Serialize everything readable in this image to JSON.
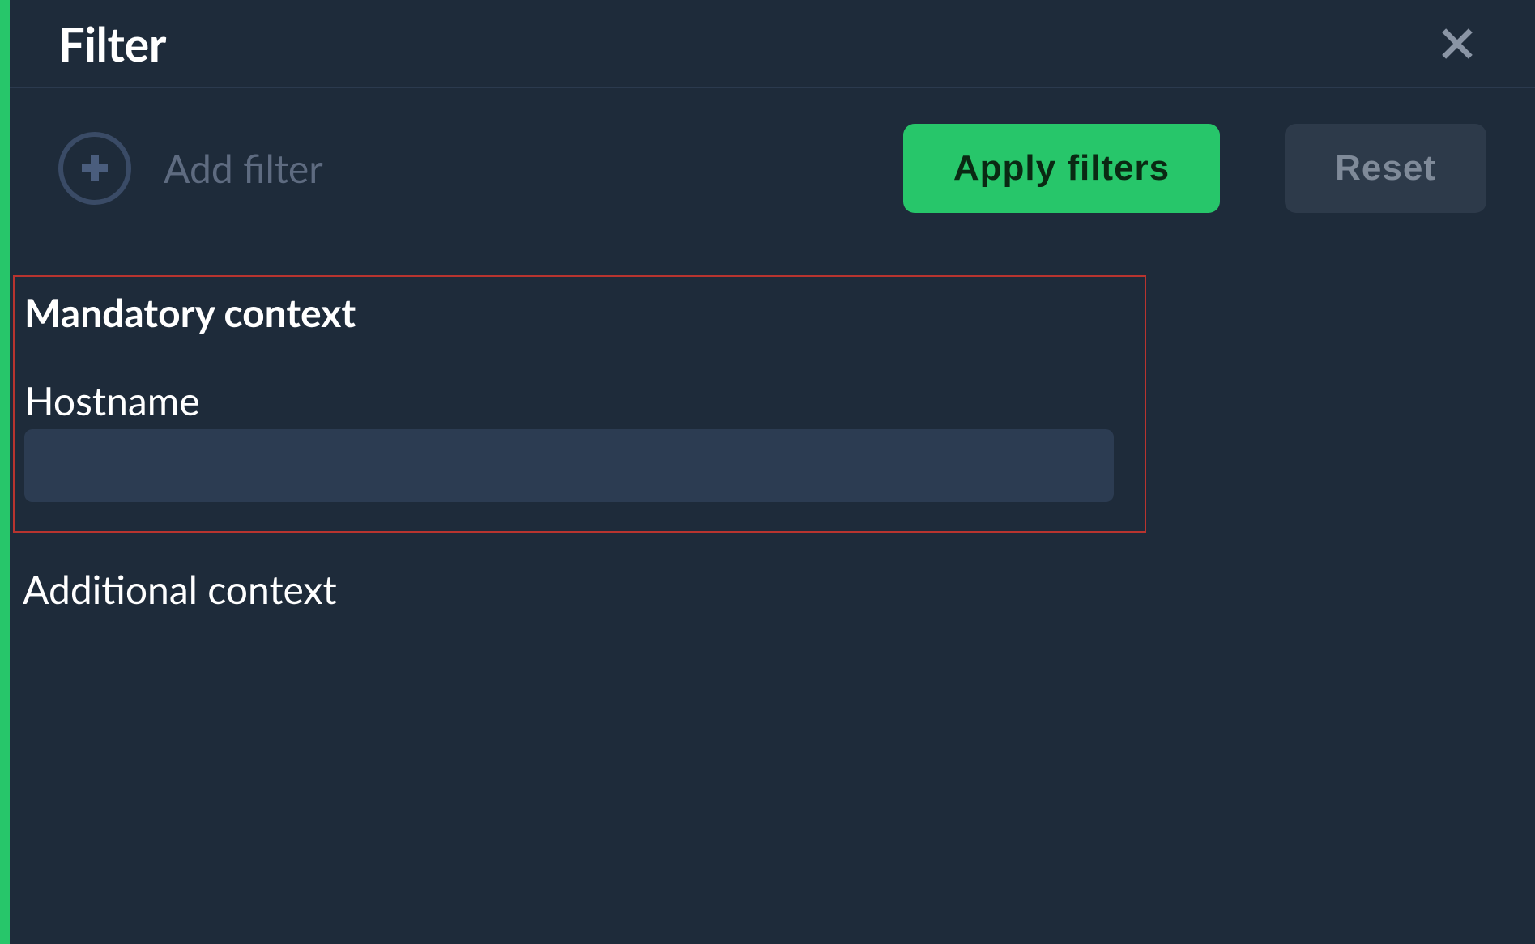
{
  "header": {
    "title": "Filter"
  },
  "toolbar": {
    "add_filter_label": "Add filter",
    "apply_label": "Apply filters",
    "reset_label": "Reset"
  },
  "sections": {
    "mandatory_heading": "Mandatory context",
    "additional_heading": "Additional context"
  },
  "fields": {
    "hostname": {
      "label": "Hostname",
      "value": ""
    }
  },
  "colors": {
    "accent": "#27c66a",
    "bg": "#1e2b3a",
    "input_bg": "#2c3c52",
    "highlight_border": "#b8342f"
  }
}
